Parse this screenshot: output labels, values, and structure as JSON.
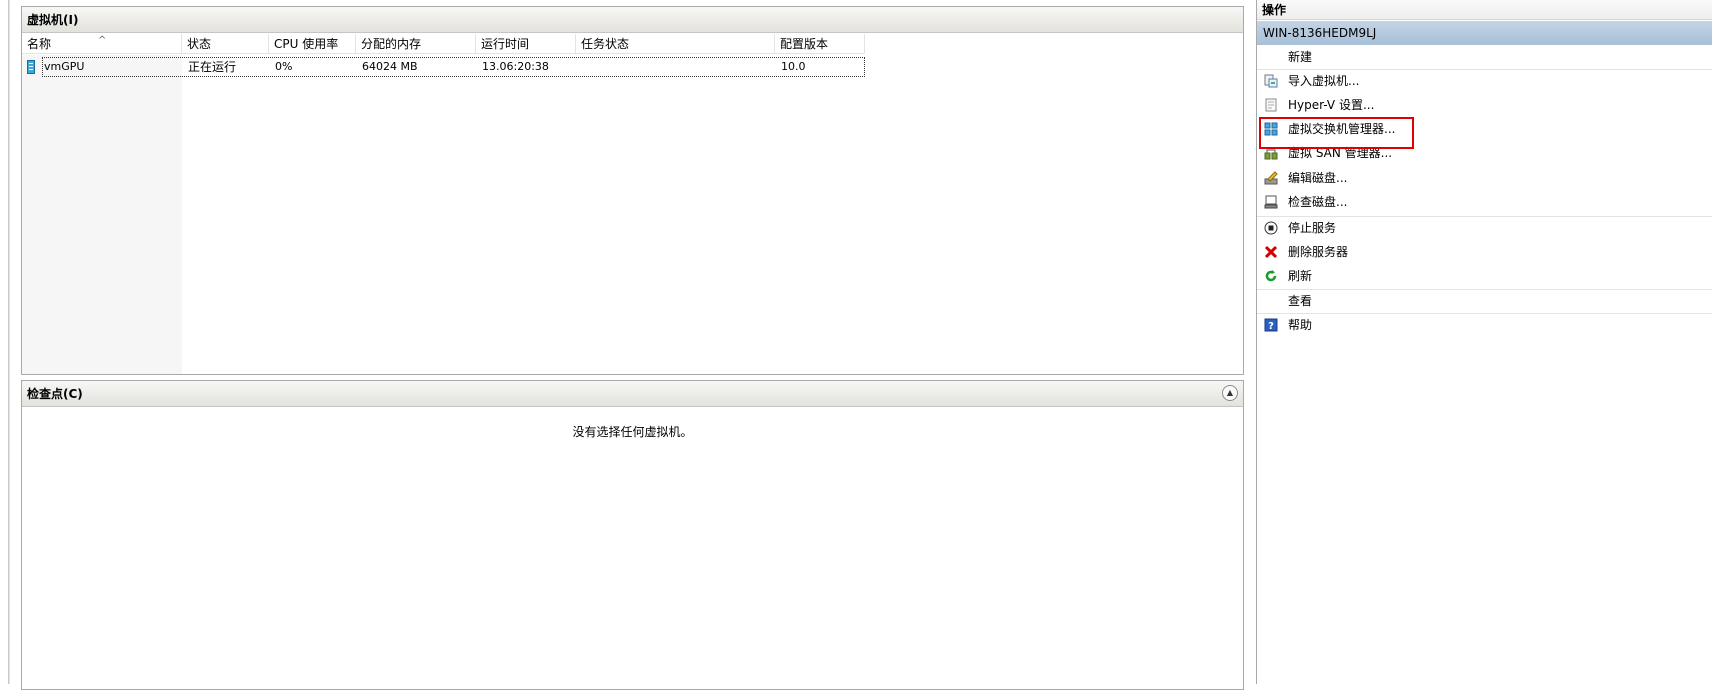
{
  "vm_panel": {
    "title": "虚拟机(I)",
    "columns": [
      "名称",
      "状态",
      "CPU 使用率",
      "分配的内存",
      "运行时间",
      "任务状态",
      "配置版本"
    ],
    "rows": [
      {
        "name": "vmGPU",
        "status": "正在运行",
        "cpu": "0%",
        "memory": "64024 MB",
        "uptime": "13.06:20:38",
        "task": "",
        "version": "10.0"
      }
    ]
  },
  "checkpoint_panel": {
    "title": "检查点(C)",
    "empty_message": "没有选择任何虚拟机。"
  },
  "actions": {
    "title": "操作",
    "server": "WIN-8136HEDM9LJ",
    "items": [
      {
        "label": "新建",
        "icon": "none"
      },
      {
        "label": "导入虚拟机...",
        "icon": "import-icon"
      },
      {
        "label": "Hyper-V 设置...",
        "icon": "settings-doc-icon"
      },
      {
        "label": "虚拟交换机管理器...",
        "icon": "switch-manager-icon"
      },
      {
        "label": "虚拟 SAN 管理器...",
        "icon": "san-manager-icon"
      },
      {
        "label": "编辑磁盘...",
        "icon": "edit-disk-icon"
      },
      {
        "label": "检查磁盘...",
        "icon": "inspect-disk-icon"
      },
      {
        "label": "停止服务",
        "icon": "stop-icon"
      },
      {
        "label": "删除服务器",
        "icon": "delete-icon"
      },
      {
        "label": "刷新",
        "icon": "refresh-icon"
      },
      {
        "label": "查看",
        "icon": "none"
      },
      {
        "label": "帮助",
        "icon": "help-icon"
      }
    ]
  },
  "colors": {
    "highlight": "#e00000",
    "server_header": "#b4c8dd",
    "delete": "#d40000",
    "refresh": "#1a9c2a",
    "help": "#2b5fbf"
  }
}
